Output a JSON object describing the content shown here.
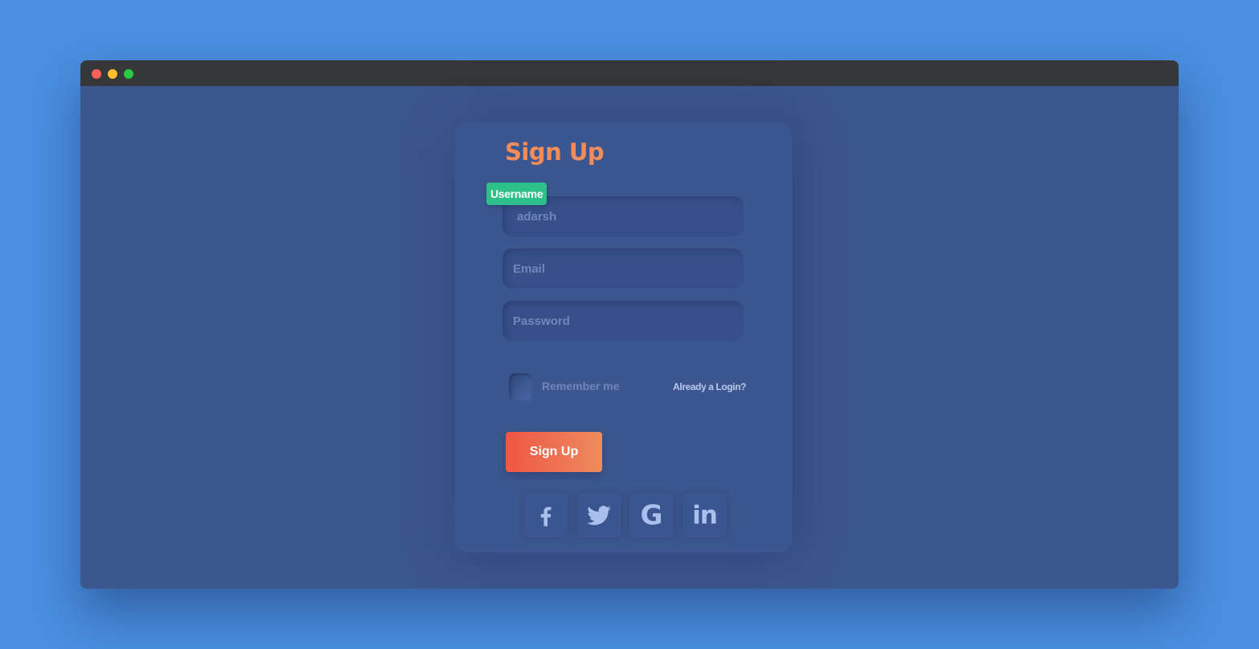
{
  "window": {
    "controls": [
      "close",
      "minimize",
      "maximize"
    ]
  },
  "form": {
    "title": "Sign Up",
    "username_label": "Username",
    "username_value": "adarsh",
    "email_placeholder": "Email",
    "password_placeholder": "Password",
    "remember_label": "Remember me",
    "login_link": "Already a Login?",
    "submit_label": "Sign Up"
  },
  "social": {
    "facebook_icon": "facebook-icon",
    "twitter_icon": "twitter-icon",
    "google_icon": "google-icon",
    "google_glyph": "G",
    "linkedin_icon": "linkedin-icon",
    "linkedin_glyph": "in"
  },
  "colors": {
    "page_background": "#4a8fe0",
    "window_background": "#3c568e",
    "titlebar": "#363739",
    "title_accent": "#f28c5a",
    "label_badge": "#2ec08a",
    "button_gradient_start": "#ef5545",
    "button_gradient_end": "#ee8c5e"
  }
}
